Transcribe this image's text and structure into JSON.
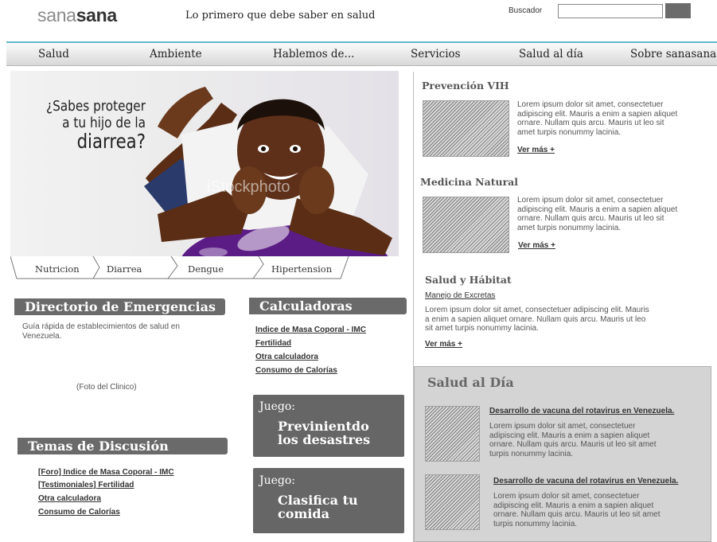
{
  "header": {
    "logo_part1": "sana",
    "logo_part2": "sana",
    "tagline": "Lo primero que debe saber en salud",
    "search_label": "Buscador",
    "search_value": ""
  },
  "nav": {
    "items": [
      {
        "label": "Salud"
      },
      {
        "label": "Ambiente"
      },
      {
        "label": "Hablemos de..."
      },
      {
        "label": "Servicios"
      },
      {
        "label": "Salud al día"
      },
      {
        "label": "Sobre sanasana"
      }
    ]
  },
  "hero": {
    "line1": "¿Sabes proteger",
    "line2": "a tu hijo de la",
    "line3": "diarrea?",
    "watermark": "iStockphoto"
  },
  "hero_tabs": [
    {
      "label": "Nutricion"
    },
    {
      "label": "Diarrea"
    },
    {
      "label": "Dengue"
    },
    {
      "label": "Hipertension"
    }
  ],
  "directorio": {
    "title": "Directorio de Emergencias",
    "description": "Guía rápida de establecimientos de salud en Venezuela.",
    "photo_placeholder": "(Foto del Clinico)"
  },
  "temas": {
    "title": "Temas de Discusión",
    "links": [
      {
        "label": "[Foro] Indice de Masa Coporal - IMC"
      },
      {
        "label": "[Testimoniales] Fertilidad"
      },
      {
        "label": "Otra calculadora"
      },
      {
        "label": "Consumo de Calorías"
      }
    ]
  },
  "calculadoras": {
    "title": "Calculadoras",
    "links": [
      {
        "label": "Indice de Masa Coporal - IMC"
      },
      {
        "label": "Fertilidad"
      },
      {
        "label": "Otra calculadora"
      },
      {
        "label": "Consumo de Calorías"
      }
    ]
  },
  "juegos": [
    {
      "kicker": "Juego:",
      "title_line1": "Previnientdo",
      "title_line2": "los desastres"
    },
    {
      "kicker": "Juego:",
      "title_line1": "Clasifica tu",
      "title_line2": "comida"
    }
  ],
  "right": {
    "prevencion": {
      "title": "Prevención VIH",
      "text_lines": [
        "Lorem ipsum dolor sit amet, consectetuer",
        "adipiscing elit. Mauris a enim a sapien aliquet",
        "ornare. Nullam quis arcu. Mauris ut leo sit",
        "amet turpis nonummy lacinia."
      ],
      "more": "Ver más +"
    },
    "medicina": {
      "title": "Medicina Natural",
      "text_lines": [
        "Lorem ipsum dolor sit amet, consectetuer",
        "adipiscing elit. Mauris a enim a sapien aliquet",
        "ornare. Nullam quis arcu. Mauris ut leo sit",
        "amet turpis nonummy lacinia."
      ],
      "more": "Ver más +"
    },
    "habitat": {
      "title": "Salud y Hábitat",
      "sublink": "Manejo de Excretas",
      "text_lines": [
        "Lorem ipsum dolor sit amet, consectetuer adipiscing elit. Mauris",
        "a enim a sapien aliquet ornare. Nullam quis arcu. Mauris ut leo",
        "sit amet turpis nonummy lacinia."
      ],
      "more": "Ver más +"
    },
    "salud_dia": {
      "title": "Salud al Día",
      "items": [
        {
          "headline": "Desarrollo de vacuna del rotavirus en Venezuela.",
          "text_lines": [
            "Lorem ipsum dolor sit amet, consectetuer",
            "adipiscing elit. Mauris a enim a sapien aliquet",
            "ornare. Nullam quis arcu. Mauris ut leo sit amet",
            "turpis nonummy lacinia."
          ]
        },
        {
          "headline": "Desarrollo de vacuna del rotavirus en Venezuela.",
          "text_lines": [
            "Lorem ipsum dolor sit amet, consectetuer",
            "adipiscing elit. Mauris a enim a sapien aliquet",
            "ornare. Nullam quis arcu. Mauris ut leo sit amet",
            "turpis nonummy lacinia."
          ]
        }
      ]
    }
  }
}
